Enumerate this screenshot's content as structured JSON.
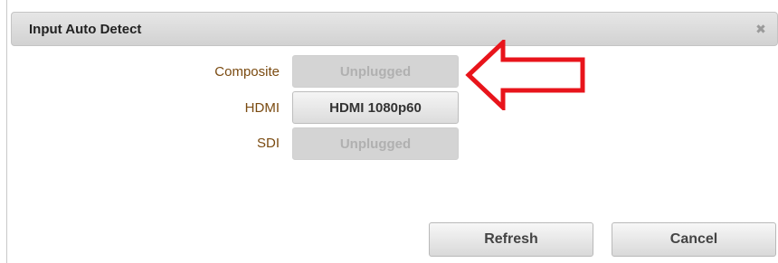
{
  "dialog": {
    "title": "Input Auto Detect",
    "close_icon": "close-icon"
  },
  "inputs": [
    {
      "label": "Composite",
      "status": "Unplugged",
      "state": "disabled"
    },
    {
      "label": "HDMI",
      "status": "HDMI 1080p60",
      "state": "active"
    },
    {
      "label": "SDI",
      "status": "Unplugged",
      "state": "disabled"
    }
  ],
  "buttons": {
    "refresh_label": "Refresh",
    "cancel_label": "Cancel"
  },
  "annotation": {
    "arrow_icon": "red-arrow-icon",
    "arrow_color": "#e8141b"
  }
}
